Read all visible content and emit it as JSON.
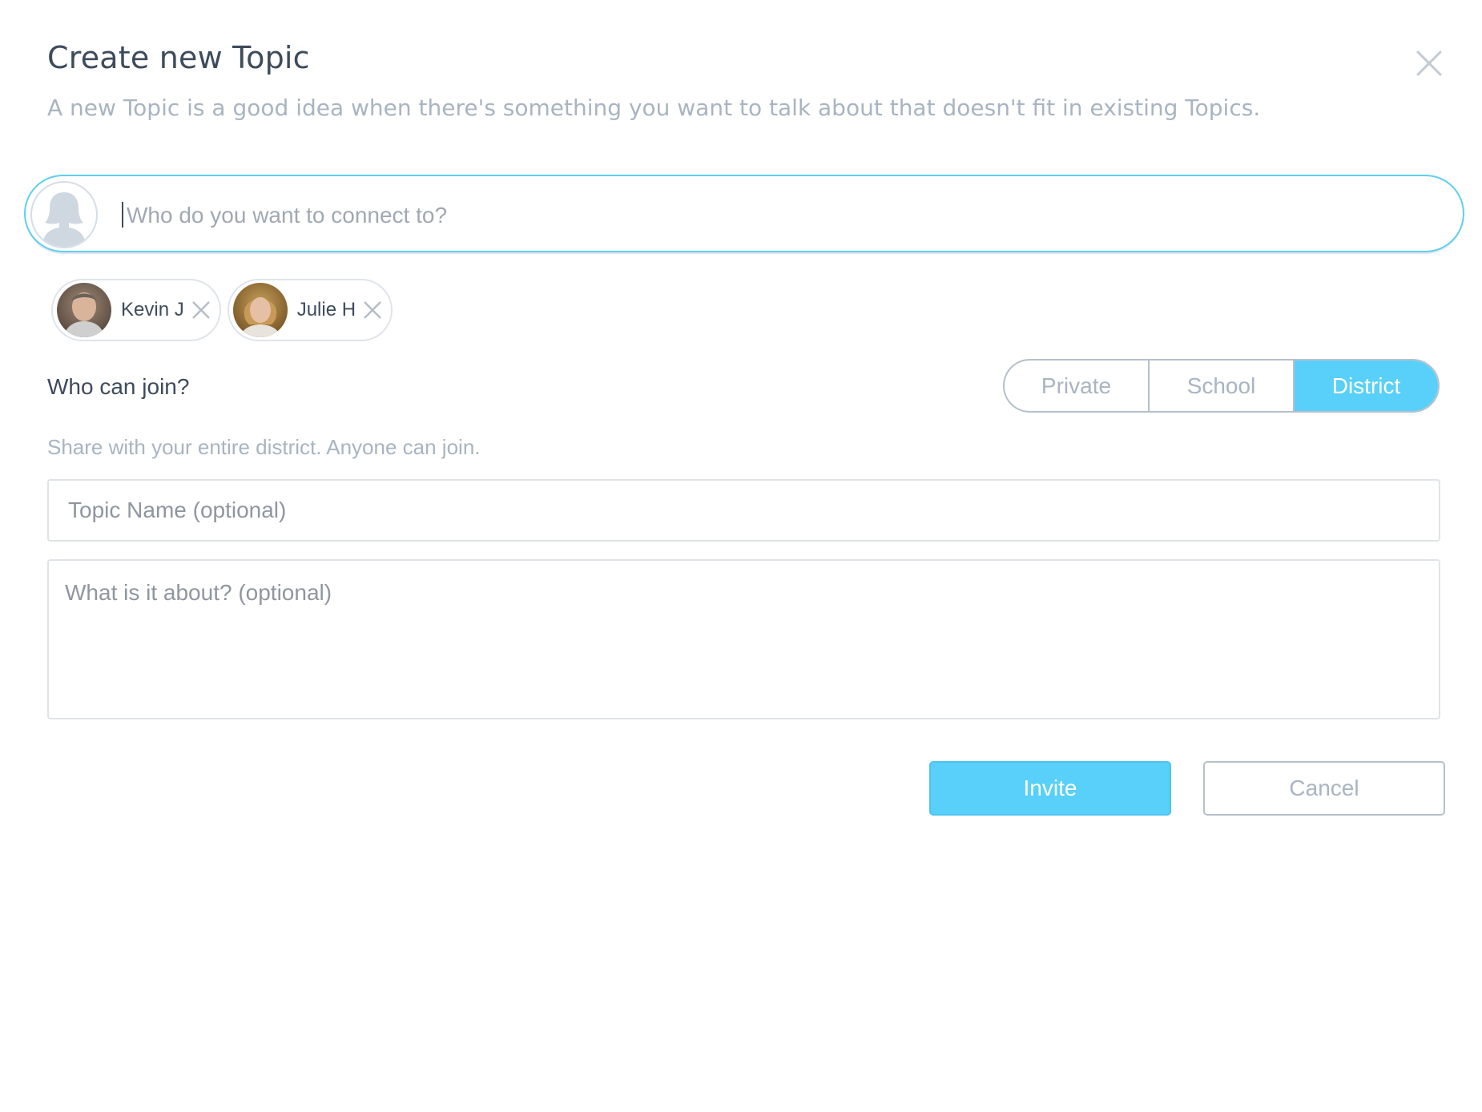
{
  "dialog": {
    "title": "Create new Topic",
    "subtitle": "A new Topic is a good idea when there's something you want to talk about that doesn't fit in existing Topics."
  },
  "connect": {
    "placeholder": "Who do you want to connect to?"
  },
  "selected_people": [
    {
      "name": "Kevin J"
    },
    {
      "name": "Julie H"
    }
  ],
  "visibility": {
    "label": "Who can join?",
    "options": [
      "Private",
      "School",
      "District"
    ],
    "selected": "District",
    "hint": "Share with your entire district. Anyone can join."
  },
  "form": {
    "topic_name_placeholder": "Topic Name (optional)",
    "about_placeholder": "What is it about? (optional)"
  },
  "actions": {
    "invite_label": "Invite",
    "cancel_label": "Cancel"
  },
  "colors": {
    "accent": "#58d0f9",
    "input_focus_border": "#5ecfee",
    "text_dark": "#3e4b5b",
    "text_muted": "#a9b4c2"
  }
}
